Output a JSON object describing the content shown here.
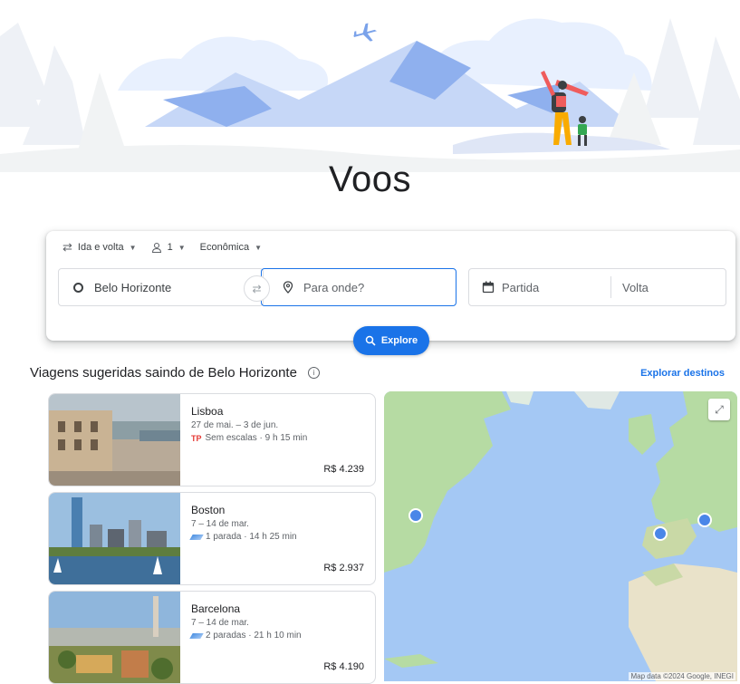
{
  "page": {
    "title": "Voos"
  },
  "search": {
    "trip_type": "Ida e volta",
    "passengers": "1",
    "cabin": "Econômica",
    "origin": "Belo Horizonte",
    "destination_placeholder": "Para onde?",
    "departure_placeholder": "Partida",
    "return_placeholder": "Volta",
    "explore_label": "Explore"
  },
  "suggestions": {
    "title": "Viagens sugeridas saindo de Belo Horizonte",
    "explore_link": "Explorar destinos",
    "trips": [
      {
        "city": "Lisboa",
        "dates": "27 de mai. – 3 de jun.",
        "flight": "Sem escalas · 9 h 15 min",
        "price": "R$ 4.239"
      },
      {
        "city": "Boston",
        "dates": "7 – 14 de mar.",
        "flight": "1 parada · 14 h 25 min",
        "price": "R$ 2.937"
      },
      {
        "city": "Barcelona",
        "dates": "7 – 14 de mar.",
        "flight": "2 paradas · 21 h 10 min",
        "price": "R$ 4.190"
      }
    ]
  },
  "map": {
    "attribution": "Map data ©2024 Google, INEGI"
  },
  "colors": {
    "accent": "#1a73e8",
    "ocean": "#a4c8f4",
    "land": "#b6dba3"
  },
  "icons": [
    "airplane-icon",
    "swap-arrows-icon",
    "person-icon",
    "chevron-down-icon",
    "location-pin-icon",
    "calendar-icon",
    "search-icon",
    "info-icon",
    "expand-icon",
    "tap-logo-icon"
  ]
}
